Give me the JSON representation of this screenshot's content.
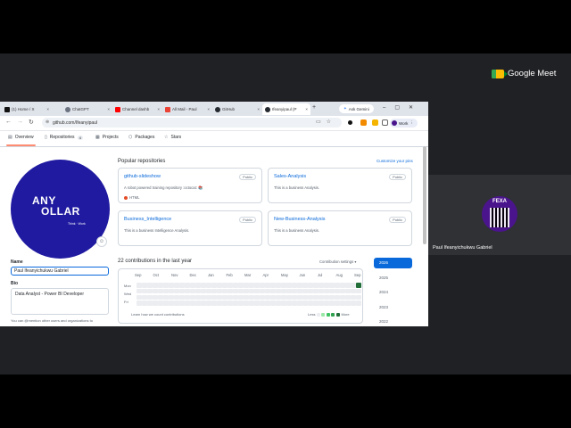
{
  "meet": {
    "brand": "Google Meet",
    "participant_name": "Paul Ifeanyichukwu Gabriel",
    "avatar_text": "FEXA"
  },
  "browser": {
    "tabs": [
      {
        "label": "(1) Home / X",
        "favicon_color": "#111111"
      },
      {
        "label": "ChatGPT",
        "favicon_color": "#6b7280"
      },
      {
        "label": "Channel dashb",
        "favicon_color": "#ff0000"
      },
      {
        "label": "All Mail - Paul",
        "favicon_color": "#ea4335"
      },
      {
        "label": "GitHub",
        "favicon_color": "#24292f"
      },
      {
        "label": "Ifeanyipaul (P",
        "favicon_color": "#24292f",
        "active": true
      }
    ],
    "new_tab": "+",
    "ask_gemini": "Ask Gemini",
    "url": "github.com/Ifeanyipaul",
    "profile_badge": "Work"
  },
  "github": {
    "nav": [
      {
        "label": "Overview",
        "icon": "book-icon"
      },
      {
        "label": "Repositories",
        "icon": "repo-icon",
        "count": "4"
      },
      {
        "label": "Projects",
        "icon": "table-icon"
      },
      {
        "label": "Packages",
        "icon": "package-icon"
      },
      {
        "label": "Stars",
        "icon": "star-icon"
      }
    ],
    "avatar": {
      "brand_line1": "ANY",
      "brand_line2": "OLLAR",
      "tagline": "Think · Work"
    },
    "name_label": "Name",
    "name_value": "Paul Ifeanyichukwu Gabriel",
    "bio_label": "Bio",
    "bio_value": "Data Analyst - Power BI Developer",
    "mention_hint": "You can @mention other users and organizations to",
    "popular_title": "Popular repositories",
    "customize": "Customize your pins",
    "repos": [
      {
        "name": "github-slideshow",
        "badge": "Public",
        "desc": "A robot powered training repository :octocat: 📚",
        "lang": "HTML"
      },
      {
        "name": "Sales-Analysis",
        "badge": "Public",
        "desc": "This is a business Analysis.",
        "lang": ""
      },
      {
        "name": "Business_Intelligence",
        "badge": "Public",
        "desc": "This is a business Intelligence Analysis.",
        "lang": ""
      },
      {
        "name": "New-Business-Analysis",
        "badge": "Public",
        "desc": "This is a business Analysis.",
        "lang": ""
      }
    ],
    "contrib_title": "22 contributions in the last year",
    "contrib_settings": "Contribution settings ▾",
    "months": [
      "Sep",
      "Oct",
      "Nov",
      "Dec",
      "Jan",
      "Feb",
      "Mar",
      "Apr",
      "May",
      "Jun",
      "Jul",
      "Aug",
      "Sep"
    ],
    "days": [
      "Mon",
      "Wed",
      "Fri"
    ],
    "learn": "Learn how we count contributions",
    "legend_less": "Less",
    "legend_more": "More",
    "legend_colors": [
      "#ebedf0",
      "#9be9a8",
      "#40c463",
      "#30a14e",
      "#216e39"
    ],
    "years": [
      "2026",
      "2025",
      "2024",
      "2023",
      "2022"
    ]
  }
}
